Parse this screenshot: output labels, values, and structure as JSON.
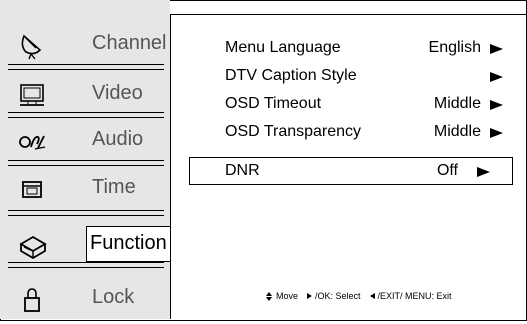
{
  "sidebar": {
    "items": [
      {
        "label": "Channel",
        "icon": "satellite-dish-icon"
      },
      {
        "label": "Video",
        "icon": "monitor-icon"
      },
      {
        "label": "Audio",
        "icon": "audio-icon"
      },
      {
        "label": "Time",
        "icon": "calendar-icon"
      },
      {
        "label": "Function",
        "icon": "box-icon"
      },
      {
        "label": "Lock",
        "icon": "padlock-icon"
      }
    ],
    "active": "Function"
  },
  "menu": {
    "rows": [
      {
        "name": "Menu Language",
        "value": "English"
      },
      {
        "name": "DTV Caption Style",
        "value": ""
      },
      {
        "name": "OSD Timeout",
        "value": "Middle"
      },
      {
        "name": "OSD Transparency",
        "value": "Middle"
      },
      {
        "name": "DNR",
        "value": "Off"
      }
    ],
    "selected": "DNR"
  },
  "hints": {
    "move": "Move",
    "ok_select": "/OK: Select",
    "exit_menu": "/EXIT/ MENU: Exit"
  }
}
